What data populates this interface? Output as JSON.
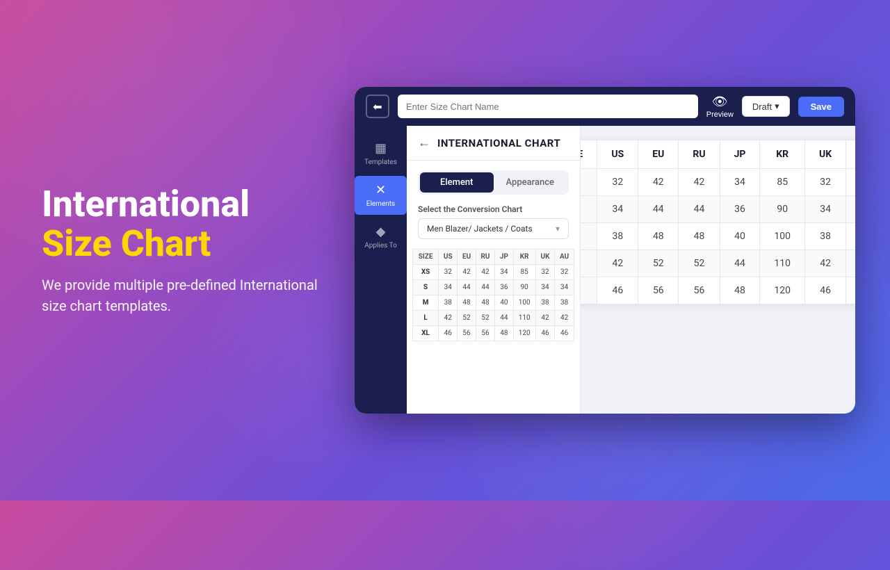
{
  "background": {
    "gradient_start": "#c84b9e",
    "gradient_end": "#4b6be8"
  },
  "left_content": {
    "heading_line1": "International",
    "heading_line2": "Size Chart",
    "description": "We provide multiple pre-defined International size chart templates."
  },
  "app": {
    "title_input_placeholder": "Enter Size Chart Name",
    "preview_label": "Preview",
    "draft_label": "Draft",
    "save_label": "Save"
  },
  "sidebar": {
    "items": [
      {
        "id": "templates",
        "label": "Templates",
        "icon": "▦"
      },
      {
        "id": "elements",
        "label": "Elements",
        "icon": "✕✕"
      },
      {
        "id": "applies-to",
        "label": "Applies To",
        "icon": "◆"
      }
    ]
  },
  "chart": {
    "title": "INTERNATIONAL CHART",
    "tabs": [
      {
        "id": "element",
        "label": "Element"
      },
      {
        "id": "appearance",
        "label": "Appearance"
      }
    ],
    "active_tab": "element",
    "conversion_label": "Select the Conversion Chart",
    "dropdown_value": "Men Blazer/ Jackets / Coats",
    "columns": [
      "SIZE",
      "US",
      "EU",
      "RU",
      "JP",
      "KR",
      "UK",
      "AU"
    ],
    "rows": [
      {
        "size": "XS",
        "us": 32,
        "eu": 42,
        "ru": 42,
        "jp": 34,
        "kr": 85,
        "uk": 32,
        "au": 32
      },
      {
        "size": "S",
        "us": 34,
        "eu": 44,
        "ru": 44,
        "jp": 36,
        "kr": 90,
        "uk": 34,
        "au": 34
      },
      {
        "size": "M",
        "us": 38,
        "eu": 48,
        "ru": 48,
        "jp": 40,
        "kr": 100,
        "uk": 38,
        "au": 38
      },
      {
        "size": "L",
        "us": 42,
        "eu": 52,
        "ru": 52,
        "jp": 44,
        "kr": 110,
        "uk": 42,
        "au": 42
      },
      {
        "size": "XL",
        "us": 46,
        "eu": 56,
        "ru": 56,
        "jp": 48,
        "kr": 120,
        "uk": 46,
        "au": 46
      }
    ]
  }
}
